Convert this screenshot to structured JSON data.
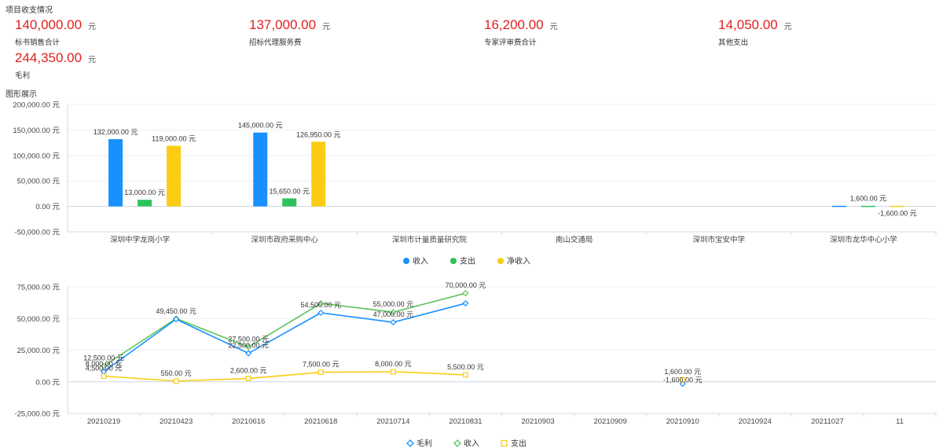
{
  "summary_title": "项目收支情况",
  "stats": [
    {
      "value": "140,000.00",
      "unit": "元",
      "label": "标书销售合计"
    },
    {
      "value": "137,000.00",
      "unit": "元",
      "label": "招标代理服务费"
    },
    {
      "value": "16,200.00",
      "unit": "元",
      "label": "专家评审费合计"
    },
    {
      "value": "14,050.00",
      "unit": "元",
      "label": "其他支出"
    },
    {
      "value": "244,350.00",
      "unit": "元",
      "label": "毛利"
    }
  ],
  "chart_section_title": "图形展示",
  "colors": {
    "blue": "#1890ff",
    "green": "#2fc25b",
    "yellow": "#facc14",
    "accent_red": "#e02020"
  },
  "chart_data": [
    {
      "type": "bar",
      "categories": [
        "深圳中学龙岗小学",
        "深圳市政府采购中心",
        "深圳市计量质量研究院",
        "南山交通局",
        "深圳市宝安中学",
        "深圳市龙华中心小学"
      ],
      "series": [
        {
          "name": "收入",
          "color": "#1890ff",
          "values": [
            132000,
            145000,
            null,
            null,
            null,
            0
          ],
          "labels": [
            "132,000.00 元",
            "145,000.00 元",
            "",
            "",
            "",
            ""
          ]
        },
        {
          "name": "支出",
          "color": "#2fc25b",
          "values": [
            13000,
            15650,
            null,
            null,
            null,
            1600
          ],
          "labels": [
            "13,000.00 元",
            "15,650.00 元",
            "",
            "",
            "",
            "1,600.00 元"
          ]
        },
        {
          "name": "净收入",
          "color": "#facc14",
          "values": [
            119000,
            126950,
            null,
            null,
            null,
            -1600
          ],
          "labels": [
            "119,000.00 元",
            "126,950.00 元",
            "",
            "",
            "",
            "-1,600.00 元"
          ]
        }
      ],
      "yticks": [
        "200,000.00 元",
        "150,000.00 元",
        "100,000.00 元",
        "50,000.00 元",
        "0.00 元",
        "-50,000.00 元"
      ],
      "ylim": [
        -50000,
        200000
      ],
      "legend_position": "bottom-center"
    },
    {
      "type": "line",
      "categories": [
        "20210219",
        "20210423",
        "20210616",
        "20210618",
        "20210714",
        "20210831",
        "20210903",
        "20210909",
        "20210910",
        "20210924",
        "20211027",
        "11"
      ],
      "series": [
        {
          "name": "毛利",
          "color": "#1890ff",
          "marker": "diamond",
          "values": [
            8000,
            49450,
            22500,
            54500,
            47000,
            62000,
            null,
            null,
            -1600,
            null,
            null,
            null
          ],
          "labels": [
            "8,000.00 元",
            "49,450.00 元",
            "22,500.00 元",
            "54,500.00 元",
            "47,000.00 元",
            "",
            "",
            "",
            "-1,600.00 元",
            "",
            "",
            ""
          ]
        },
        {
          "name": "收入",
          "color": "#5cc35c",
          "marker": "diamond",
          "values": [
            12500,
            50000,
            27500,
            62000,
            55000,
            70000,
            null,
            null,
            null,
            null,
            null,
            null
          ],
          "labels": [
            "12,500.00 元",
            "",
            "27,500.00 元",
            "",
            "55,000.00 元",
            "70,000.00 元",
            "",
            "",
            "",
            "",
            "",
            ""
          ]
        },
        {
          "name": "支出",
          "color": "#facc14",
          "marker": "square",
          "values": [
            4500,
            550,
            2600,
            7500,
            8000,
            5500,
            null,
            null,
            1600,
            null,
            null,
            null
          ],
          "labels": [
            "4,500.00 元",
            "550.00 元",
            "2,600.00 元",
            "7,500.00 元",
            "8,000.00 元",
            "5,500.00 元",
            "",
            "",
            "1,600.00 元",
            "",
            "",
            ""
          ]
        }
      ],
      "yticks": [
        "75,000.00 元",
        "50,000.00 元",
        "25,000.00 元",
        "0.00 元",
        "-25,000.00 元"
      ],
      "ylim": [
        -25000,
        75000
      ],
      "legend_position": "bottom-center"
    }
  ]
}
